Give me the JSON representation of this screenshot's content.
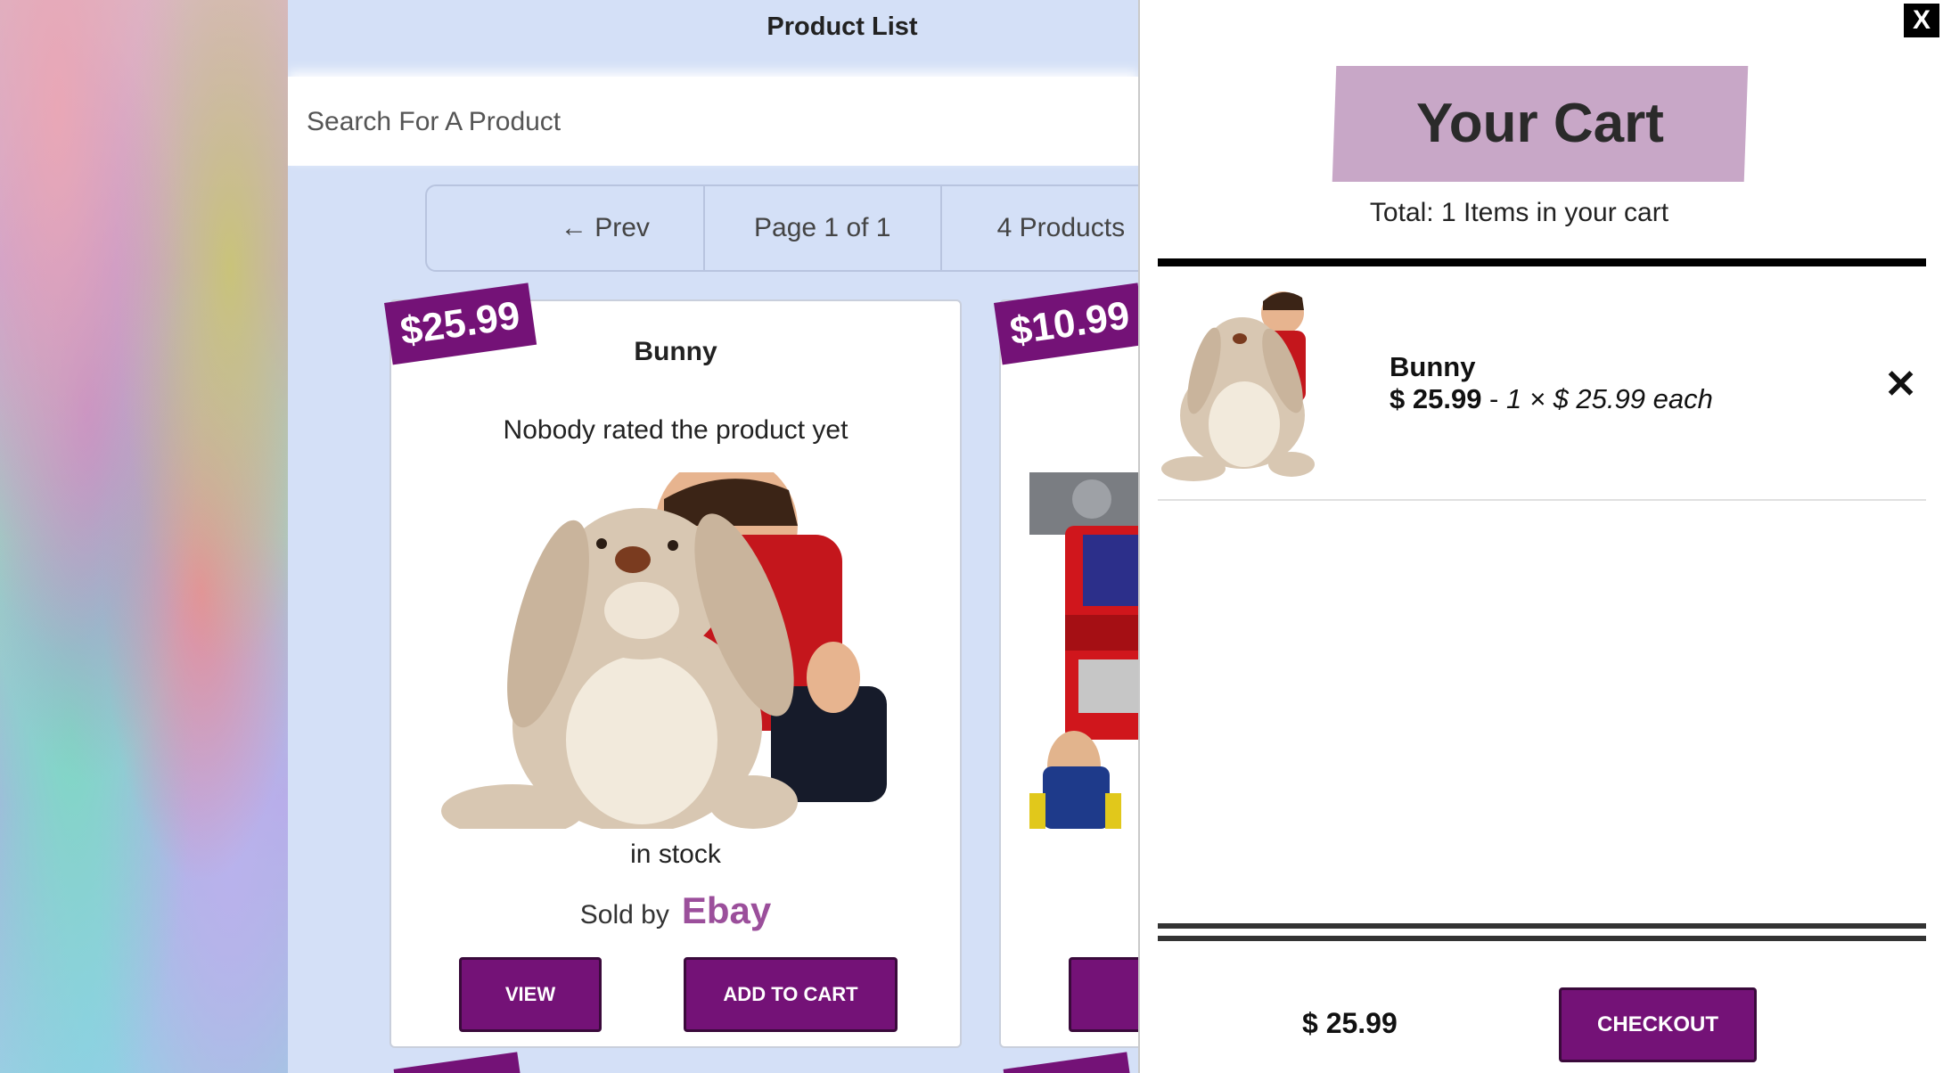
{
  "page": {
    "title": "Product List",
    "search_placeholder": "Search For A Product"
  },
  "pager": {
    "prev_label": "← Prev",
    "page_label": "Page 1 of 1",
    "count_label": "4 Products"
  },
  "products": [
    {
      "price": "$25.99",
      "name": "Bunny",
      "rating": "Nobody rated the product yet",
      "stock": "in stock",
      "sold_by_label": "Sold by",
      "seller": "Ebay",
      "view_label": "VIEW",
      "add_label": "ADD TO CART"
    },
    {
      "price": "$10.99"
    }
  ],
  "cart": {
    "close_label": "X",
    "title": "Your Cart",
    "total_line": "Total: 1 Items in your cart",
    "items": [
      {
        "name": "Bunny",
        "price": "$ 25.99",
        "separator": " - ",
        "qty_line": "1 × $ 25.99 each",
        "remove_label": "✕"
      }
    ],
    "sum": "$ 25.99",
    "checkout_label": "CHECKOUT"
  },
  "colors": {
    "accent": "#741277",
    "cart_title_bg": "#c8a7c7",
    "seller": "#9b4f9b",
    "page_bg": "#d4e0f7"
  }
}
